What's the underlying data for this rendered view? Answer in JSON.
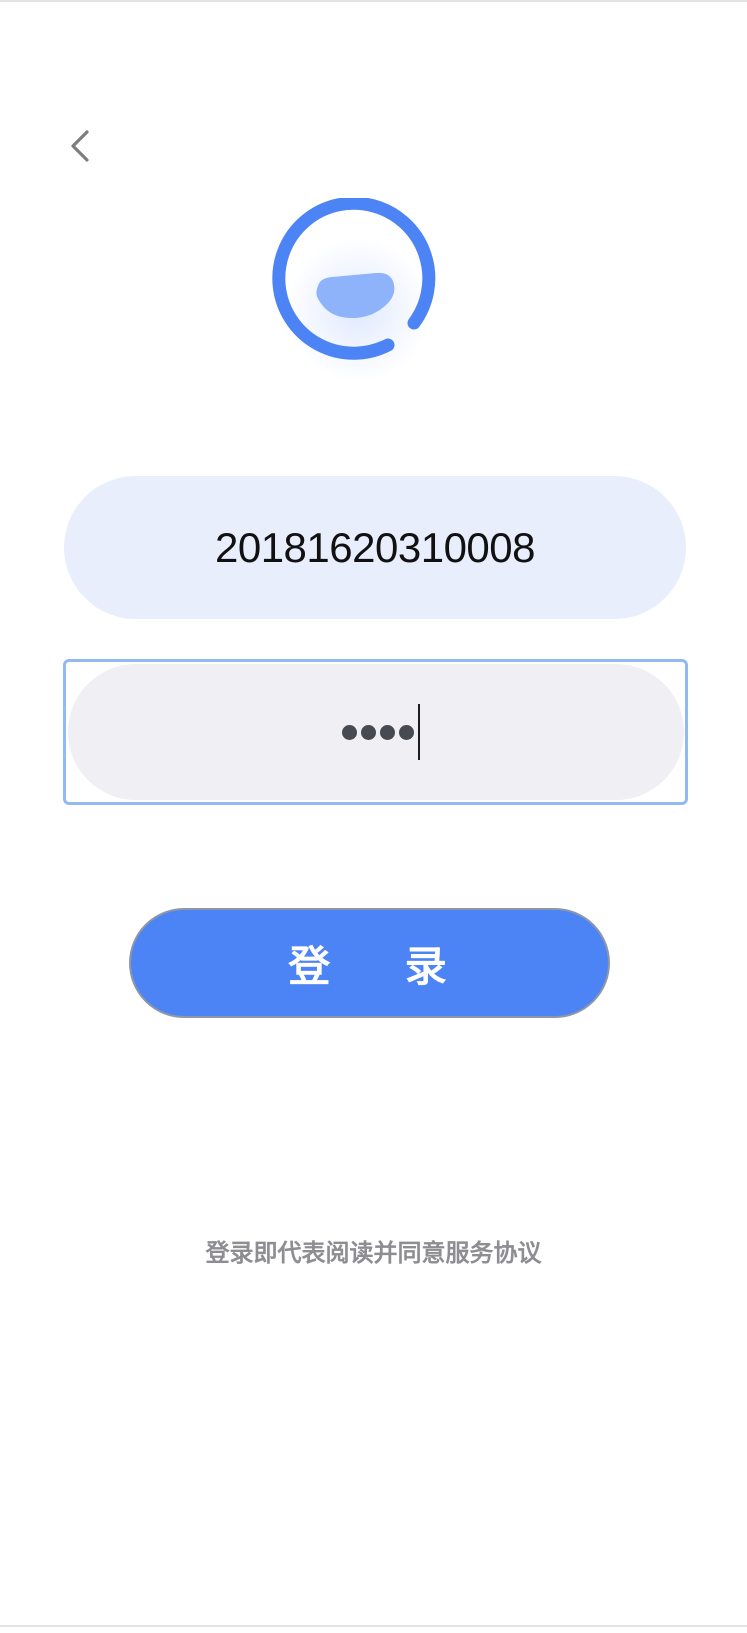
{
  "header": {
    "back_icon": "chevron-left-icon"
  },
  "logo": {
    "icon": "app-logo-icon",
    "colors": {
      "ring": "#4c84f6",
      "shape": "#8eb3fa"
    }
  },
  "account": {
    "value": "20181620310008"
  },
  "password": {
    "masked_length": 4,
    "focused": true
  },
  "login_button": {
    "label": "登 录"
  },
  "agreement": {
    "text": "登录即代表阅读并同意服务协议"
  },
  "colors": {
    "accent": "#4c84f6",
    "input_bg_account": "#e9eefc",
    "input_bg_password": "#efeff4",
    "focus_border": "#93b9f3",
    "muted_text": "#8d8d92"
  }
}
